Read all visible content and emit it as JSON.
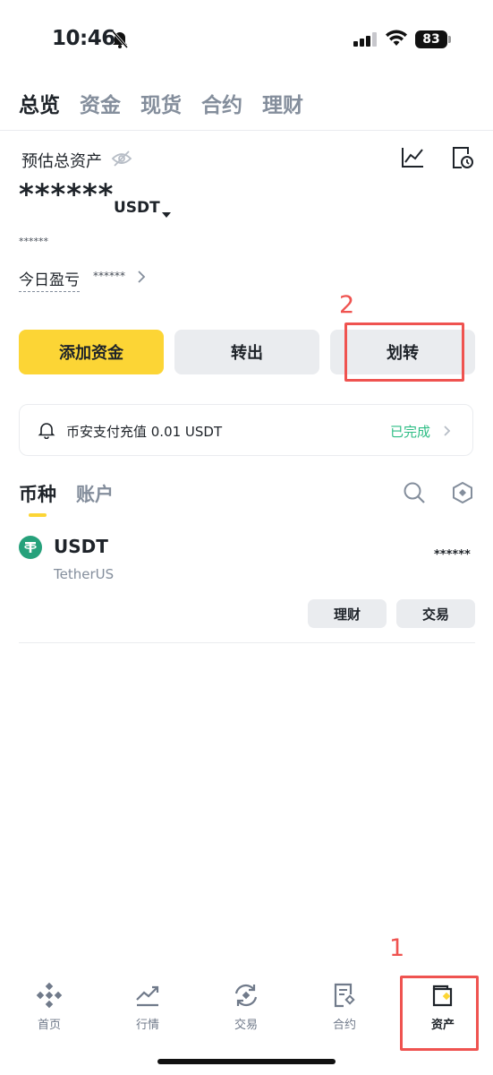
{
  "status_bar": {
    "time": "10:46",
    "battery": "83"
  },
  "top_tabs": [
    {
      "label": "总览",
      "active": true
    },
    {
      "label": "资金",
      "active": false
    },
    {
      "label": "现货",
      "active": false
    },
    {
      "label": "合约",
      "active": false
    },
    {
      "label": "理财",
      "active": false
    }
  ],
  "overview": {
    "est_label": "预估总资产",
    "balance_masked": "******",
    "currency": "USDT",
    "small_masked": "******",
    "pnl_label": "今日盈亏",
    "pnl_value": "******"
  },
  "actions": {
    "deposit": "添加资金",
    "withdraw": "转出",
    "transfer": "划转"
  },
  "annotations": {
    "one": "1",
    "two": "2"
  },
  "notice": {
    "text": "币安支付充值 0.01 USDT",
    "status": "已完成"
  },
  "list_tabs": {
    "coins": "币种",
    "accounts": "账户"
  },
  "asset": {
    "symbol": "USDT",
    "name": "TetherUS",
    "amount": "******",
    "earn_btn": "理财",
    "trade_btn": "交易"
  },
  "bottom_nav": [
    {
      "label": "首页",
      "icon": "binance-logo-icon"
    },
    {
      "label": "行情",
      "icon": "market-chart-icon"
    },
    {
      "label": "交易",
      "icon": "trade-swap-icon"
    },
    {
      "label": "合约",
      "icon": "futures-doc-icon"
    },
    {
      "label": "资产",
      "icon": "wallet-icon",
      "active": true
    }
  ],
  "colors": {
    "brand_yellow": "#fcd535",
    "success_green": "#2ebd85",
    "annotation_red": "#ef5350"
  }
}
